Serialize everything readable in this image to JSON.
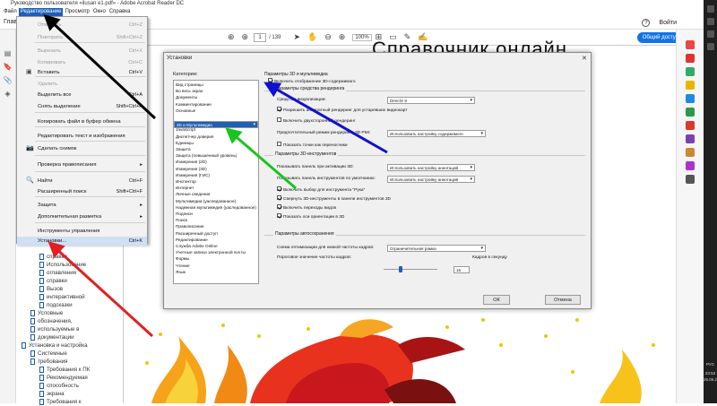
{
  "window": {
    "title": "Руководство пользователя «ilusan e1.pdf» - Adobe Acrobat Reader DC"
  },
  "menubar": {
    "items": [
      "Файл",
      "Редактирование",
      "Просмотр",
      "Окно",
      "Справка"
    ]
  },
  "tabbar": {
    "home": "Главная",
    "help": "?",
    "signin": "Войти"
  },
  "toolbar": {
    "page": "1",
    "pages": "/ 139",
    "zoom": "100%",
    "share": "Общий доступ"
  },
  "doc": {
    "title": "Справочник онлайн"
  },
  "edit_menu": {
    "items": [
      {
        "label": "Отменить",
        "shortcut": "Ctrl+Z",
        "disabled": true
      },
      {
        "label": "Повторить",
        "shortcut": "Shift+Ctrl+Z",
        "disabled": true
      },
      {
        "label": "Вырезать",
        "shortcut": "Ctrl+X",
        "disabled": true
      },
      {
        "label": "Копировать",
        "shortcut": "Ctrl+C",
        "disabled": true
      },
      {
        "label": "Вставить",
        "shortcut": "Ctrl+V",
        "disabled": false
      },
      {
        "label": "Удалить",
        "shortcut": "",
        "disabled": true
      },
      {
        "label": "Выделить все",
        "shortcut": "Ctrl+A",
        "disabled": false
      },
      {
        "label": "Снять выделение",
        "shortcut": "Shift+Ctrl+A",
        "disabled": false
      },
      {
        "label": "Копировать файл в буфер обмена",
        "shortcut": "",
        "disabled": false
      },
      {
        "label": "Редактировать текст и изображения",
        "shortcut": "",
        "disabled": false
      },
      {
        "label": "Сделать снимок",
        "shortcut": "",
        "disabled": false
      },
      {
        "label": "Проверка правописания",
        "shortcut": "▸",
        "disabled": false
      },
      {
        "label": "Найти",
        "shortcut": "Ctrl+F",
        "disabled": false
      },
      {
        "label": "Расширенный поиск",
        "shortcut": "Shift+Ctrl+F",
        "disabled": false
      },
      {
        "label": "Защита",
        "shortcut": "▸",
        "disabled": false
      },
      {
        "label": "Дополнительная разметка",
        "shortcut": "▸",
        "disabled": false
      },
      {
        "label": "Инструменты управления",
        "shortcut": "",
        "disabled": false
      },
      {
        "label": "Установки...",
        "shortcut": "Ctrl+K",
        "disabled": false
      }
    ]
  },
  "nav": {
    "items": [
      {
        "label": "справки",
        "indent": 2
      },
      {
        "label": "Использование",
        "indent": 2
      },
      {
        "label": "оглавления",
        "indent": 2
      },
      {
        "label": "справки",
        "indent": 2
      },
      {
        "label": "Вызов",
        "indent": 2
      },
      {
        "label": "интерактивной",
        "indent": 2
      },
      {
        "label": "подсказки",
        "indent": 2
      },
      {
        "label": "Условные",
        "indent": 1
      },
      {
        "label": "обозначения,",
        "indent": 1
      },
      {
        "label": "используемые в",
        "indent": 1
      },
      {
        "label": "документации",
        "indent": 1
      },
      {
        "label": "Установка и настройка",
        "indent": 0
      },
      {
        "label": "Системные",
        "indent": 1
      },
      {
        "label": "требования",
        "indent": 1
      },
      {
        "label": "Требования к ПК",
        "indent": 2
      },
      {
        "label": "Рекомендуемая",
        "indent": 2
      },
      {
        "label": "способность",
        "indent": 2
      },
      {
        "label": "экрана",
        "indent": 2
      },
      {
        "label": "Требования к",
        "indent": 2
      }
    ]
  },
  "dialog": {
    "title": "Установки",
    "close": "✕",
    "categories_label": "Категории:",
    "categories": [
      "Вид страницы",
      "Во весь экран",
      "Документы",
      "Комментирование",
      "Основные",
      "",
      "3D и Мультимедиа",
      "JavaScript",
      "Диспетчер доверия",
      "Единицы",
      "Защита",
      "Защита (повышенный уровень)",
      "Измерения (2D)",
      "Измерения (3D)",
      "Измерения (ГИС)",
      "Инспектор",
      "Интернет",
      "Личные сведения",
      "Мультимедиа (уаследованное)",
      "Надежная мультимедия (уаследованное)",
      "Подписи",
      "Поиск",
      "Правописание",
      "Расширенный доступ",
      "Редактирование",
      "Служба Adobe Online",
      "Учетные записи электронной почты",
      "Формы",
      "Чтение",
      "Язык"
    ],
    "selected_category": "3D и Мультимедиа",
    "section1": "Параметры 3D и мультимедиа",
    "enable3d": "Включить отображение 3D-содержимого",
    "renderer_group": "Параметры средства рендеринга",
    "renderer_label": "Средство визуализации:",
    "renderer_value": "DirectX 9",
    "hw_renderer": "Разрешить аппаратный рендеринг для устаревших видеокарт",
    "double_sided": "Включить двухсторонний рендеринг",
    "pmi_label": "Предпочтительный режим рендеринга 3D PMI:",
    "pmi_value": "Использовать настройку содержимого",
    "show_through": "Показать точки как переносчики",
    "tools_group": "Параметры 3D-инструментов",
    "show_panel_label": "Показывать панель при активации 3D:",
    "show_panel_value": "Использовать настройку аннотаций",
    "default_tools_label": "Показывать панель инструментов по умолчанию:",
    "default_tools_value": "Использовать настройку аннотаций",
    "opt_select": "Включить выбор для инструмента \"Рука\"",
    "opt_collapse": "Свернуть 3D-инструменты в панели инструментов 3D",
    "opt_transitions": "Включить переходы видов",
    "opt_axes": "Показать оси ориентации в 3D",
    "autosave_group": "Параметры автосохранения",
    "optimize_label": "Схема оптимизации для низкой частоты кадров:",
    "optimize_value": "Ограничительная рамка",
    "fps_label": "Пороговое значение частоты кадров:",
    "fps_value": "15",
    "fps_unit": "Кадров в секунду",
    "ok": "ОК",
    "cancel": "Отмена"
  },
  "taskbar": {
    "lang": "РУС",
    "time": "23:53",
    "date": "25.05.2019"
  },
  "colors": {
    "accent": "#1e5fb8",
    "share": "#1473e6",
    "arrow_red": "#e02020",
    "arrow_green": "#18c41e",
    "arrow_blue": "#1010d0",
    "arrow_black": "#000000"
  }
}
